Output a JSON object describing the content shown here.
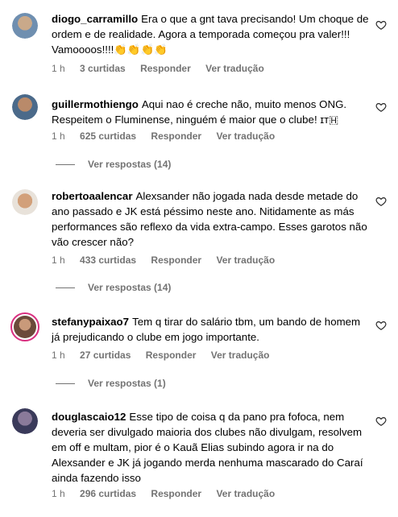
{
  "comments": [
    {
      "username": "diogo_carramillo",
      "text": "Era o que a gnt tava precisando! Um choque de ordem e de realidade. Agora a temporada começou pra valer!!! Vamoooos!!!!👏👏👏👏",
      "time": "1 h",
      "likes": "3 curtidas",
      "reply": "Responder",
      "translate": "Ver tradução"
    },
    {
      "username": "guillermothiengo",
      "text": "Aqui nao é creche não, muito menos ONG. Respeitem o Fluminense, ninguém é maior que o clube! ɪᴛ🇭",
      "time": "1 h",
      "likes": "625 curtidas",
      "reply": "Responder",
      "translate": "Ver tradução",
      "view_replies": "Ver respostas (14)"
    },
    {
      "username": "robertoaalencar",
      "text": "Alexsander não jogada nada desde metade do ano passado e JK está péssimo neste ano. Nitidamente as más performances são reflexo da vida extra-campo. Esses garotos não vão crescer não?",
      "time": "1 h",
      "likes": "433 curtidas",
      "reply": "Responder",
      "translate": "Ver tradução",
      "view_replies": "Ver respostas (14)"
    },
    {
      "username": "stefanypaixao7",
      "text": "Tem q tirar do salário tbm, um bando de homem já prejudicando o clube em jogo importante.",
      "time": "1 h",
      "likes": "27 curtidas",
      "reply": "Responder",
      "translate": "Ver tradução",
      "view_replies": "Ver respostas (1)"
    },
    {
      "username": "douglascaio12",
      "text": "Esse tipo de coisa q da pano pra fofoca, nem deveria ser divulgado maioria dos clubes não divulgam, resolvem em off e multam, pior é o Kauã Elias subindo agora ir na do Alexsander e JK já jogando merda nenhuma mascarado do Caraí ainda fazendo isso",
      "time": "1 h",
      "likes": "296 curtidas",
      "reply": "Responder",
      "translate": "Ver tradução"
    }
  ],
  "icons": {
    "like": "heart-outline-icon",
    "avatar": "profile-picture"
  },
  "colors": {
    "secondary_text": "#737373",
    "story_ring": "#d92e7f"
  }
}
